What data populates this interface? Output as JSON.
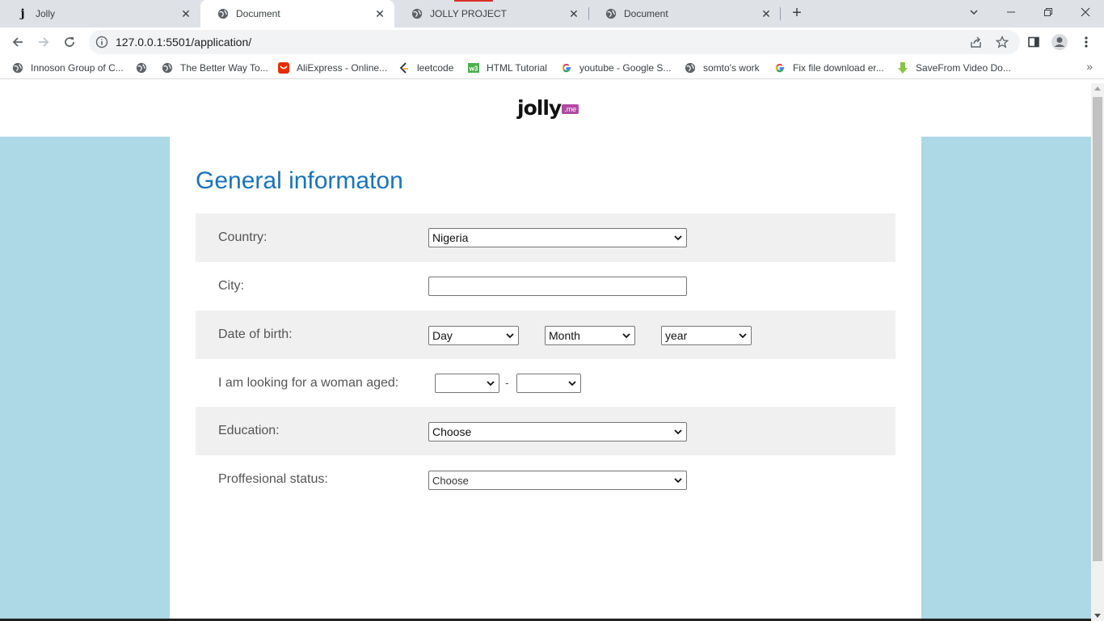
{
  "browser": {
    "tabs": [
      {
        "title": "Jolly",
        "icon": "jolly-j-icon",
        "active": false
      },
      {
        "title": "Document",
        "icon": "globe-icon",
        "active": true
      },
      {
        "title": "JOLLY PROJECT",
        "icon": "globe-icon",
        "active": false
      },
      {
        "title": "Document",
        "icon": "globe-icon",
        "active": false
      }
    ],
    "url": "127.0.0.1:5501/application/",
    "bookmarks": [
      {
        "label": "Innoson Group of C...",
        "icon": "globe-icon"
      },
      {
        "label": "",
        "icon": "globe-icon"
      },
      {
        "label": "The Better Way To...",
        "icon": "globe-icon"
      },
      {
        "label": "AliExpress - Online...",
        "icon": "aliexpress-icon"
      },
      {
        "label": "leetcode",
        "icon": "leetcode-icon"
      },
      {
        "label": "HTML Tutorial",
        "icon": "w3schools-icon"
      },
      {
        "label": "youtube - Google S...",
        "icon": "google-icon"
      },
      {
        "label": "somto's work",
        "icon": "globe-icon"
      },
      {
        "label": "Fix file download er...",
        "icon": "google-icon"
      },
      {
        "label": "SaveFrom Video Do...",
        "icon": "savefrom-icon"
      }
    ],
    "more_bookmarks": "»"
  },
  "page": {
    "logo": {
      "word": "jolly",
      "badge": ".me"
    },
    "section_title": "General informaton",
    "form": {
      "country": {
        "label": "Country:",
        "value": "Nigeria"
      },
      "city": {
        "label": "City:",
        "value": ""
      },
      "dob": {
        "label": "Date of birth:",
        "day": "Day",
        "month": "Month",
        "year": "year"
      },
      "age_range": {
        "label": "I am looking for a woman aged:",
        "from": "",
        "to": "",
        "separator": "-"
      },
      "education": {
        "label": "Education:",
        "value": "Choose"
      },
      "professional_status": {
        "label": "Proffesional status:",
        "value": "Choose"
      }
    }
  },
  "colors": {
    "page_bg": "#add8e6",
    "title": "#1a73b8",
    "row_shade": "#f0f0f0",
    "logo_badge": "#b04aa4"
  }
}
